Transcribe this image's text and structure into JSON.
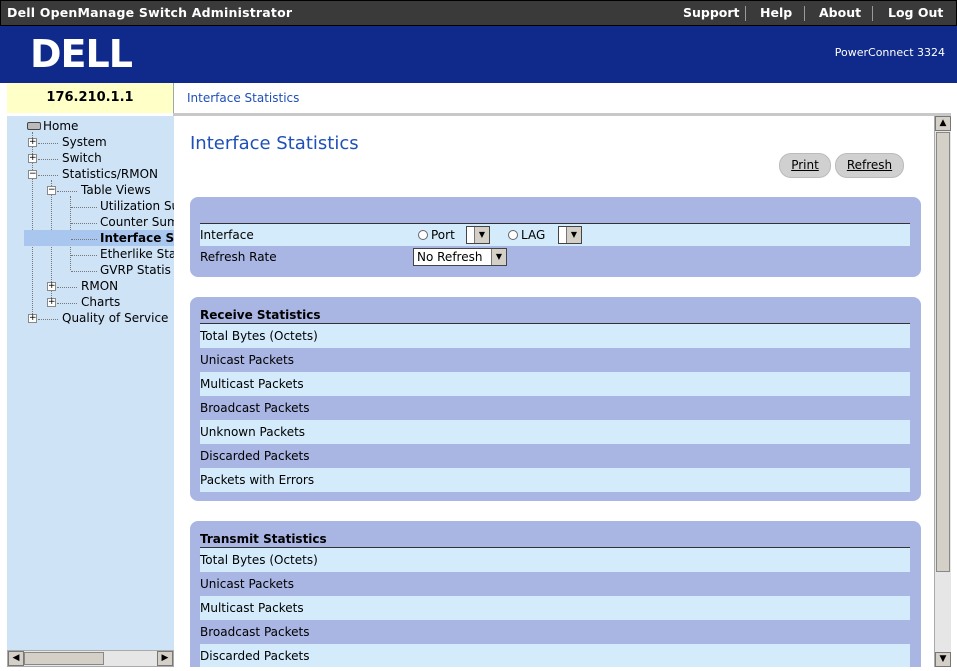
{
  "app": {
    "title": "Dell OpenManage Switch Administrator"
  },
  "toplinks": [
    "Support",
    "Help",
    "About",
    "Log Out"
  ],
  "banner": {
    "logo": "DELL",
    "model": "PowerConnect 3324"
  },
  "device": {
    "ip": "176.210.1.1"
  },
  "breadcrumb": "Interface Statistics",
  "tree": {
    "home": "Home",
    "system": "System",
    "switch": "Switch",
    "stats_rmon": "Statistics/RMON",
    "table_views": "Table Views",
    "utilization": "Utilization Su",
    "counter": "Counter Sum",
    "interface": "Interface St",
    "etherlike": "Etherlike Sta",
    "gvrp": "GVRP Statis",
    "rmon": "RMON",
    "charts": "Charts",
    "qos": "Quality of Service"
  },
  "page": {
    "title": "Interface Statistics",
    "print_label": "Print",
    "refresh_label": "Refresh"
  },
  "settings": {
    "interface_label": "Interface",
    "port_label": "Port",
    "port_value": "",
    "lag_label": "LAG",
    "lag_value": "",
    "refresh_rate_label": "Refresh Rate",
    "refresh_rate_value": "No Refresh"
  },
  "receive": {
    "heading": "Receive Statistics",
    "rows": [
      "Total Bytes (Octets)",
      "Unicast Packets",
      "Multicast Packets",
      "Broadcast Packets",
      "Unknown Packets",
      "Discarded Packets",
      "Packets with Errors"
    ]
  },
  "transmit": {
    "heading": "Transmit Statistics",
    "rows": [
      "Total Bytes (Octets)",
      "Unicast Packets",
      "Multicast Packets",
      "Broadcast Packets",
      "Discarded Packets"
    ]
  },
  "colors": {
    "banner": "#0f2a8a",
    "title": "#1f4fb8",
    "panel": "#a9b5e3",
    "row_light": "#d4ebfb",
    "tree_bg": "#cfe3f7",
    "ip_bg": "#ffffc8"
  }
}
